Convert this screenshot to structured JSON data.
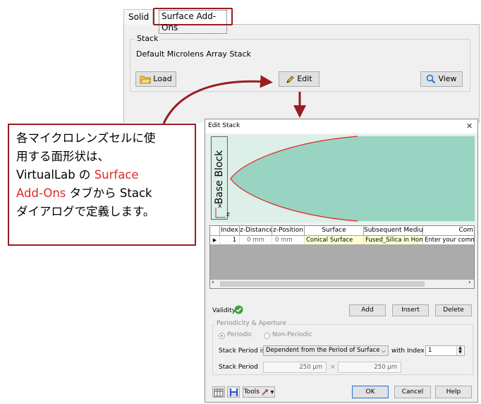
{
  "tabs": {
    "solid": "Solid",
    "surface_addons": "Surface Add-Ons"
  },
  "stack": {
    "group_title": "Stack",
    "name": "Default Microlens Array Stack",
    "load": "Load",
    "edit": "Edit",
    "view": "View"
  },
  "callout": {
    "line1": "各マイクロレンズセルに使",
    "line2": "用する面形状は、",
    "line3a": "VirtualLab の ",
    "line3b": "Surface",
    "line4a": "Add-Ons",
    "line4b": " タブから Stack",
    "line5": "ダイアログで定義します。"
  },
  "dialog": {
    "title": "Edit Stack",
    "close": "✕",
    "preview": {
      "label": "Base Block",
      "axis_x": "x",
      "axis_z": "z"
    },
    "table": {
      "headers": [
        "Index",
        "z-Distance",
        "z-Position",
        "Surface",
        "Subsequent Medium",
        "Com"
      ],
      "row": {
        "index": "1",
        "z_distance": "0 mm",
        "z_position": "0 mm",
        "surface": "Conical Surface",
        "medium": "Fused_Silica in Homog",
        "comment": "Enter your commen"
      }
    },
    "validity": "Validity:",
    "add": "Add",
    "insert": "Insert",
    "delete": "Delete",
    "periodicity": {
      "title": "Periodicity & Aperture",
      "periodic": "Periodic",
      "nonperiodic": "Non-Periodic",
      "stack_period_is_label": "Stack Period is",
      "stack_period_is_value": "Dependent from the Period of Surface",
      "with_index_label": "with Index",
      "with_index_value": "1",
      "stack_period_label": "Stack Period",
      "period_x": "250 µm",
      "times": "×",
      "period_y": "250 µm"
    },
    "footer": {
      "tools": "Tools",
      "ok": "OK",
      "cancel": "Cancel",
      "help": "Help"
    }
  },
  "colors": {
    "accent_red": "#9a1c21",
    "surface_red": "#e3262a",
    "teal": "#99d3c2",
    "light_teal": "#dcefe8"
  }
}
